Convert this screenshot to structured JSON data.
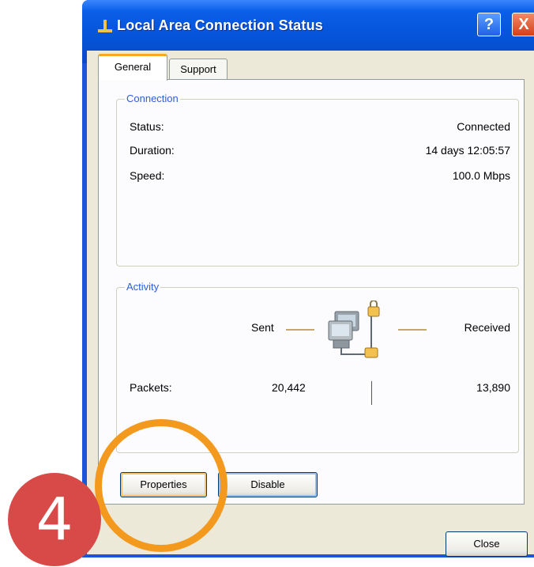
{
  "window": {
    "title": "Local Area Connection Status",
    "help_glyph": "?",
    "close_glyph": "X"
  },
  "tabs": [
    {
      "label": "General",
      "selected": true
    },
    {
      "label": "Support",
      "selected": false
    }
  ],
  "connection": {
    "group_label": "Connection",
    "rows": [
      {
        "label": "Status:",
        "value": "Connected"
      },
      {
        "label": "Duration:",
        "value": "14 days 12:05:57"
      },
      {
        "label": "Speed:",
        "value": "100.0 Mbps"
      }
    ]
  },
  "activity": {
    "group_label": "Activity",
    "sent_label": "Sent",
    "received_label": "Received",
    "packets_label": "Packets:",
    "packets_sent": "20,442",
    "packets_received": "13,890",
    "icon": "network-computers-icon"
  },
  "buttons": {
    "properties": "Properties",
    "disable": "Disable",
    "close": "Close"
  },
  "annotation": {
    "step_number": "4",
    "ring_color": "#f39a1e",
    "badge_color": "#d84a47"
  }
}
